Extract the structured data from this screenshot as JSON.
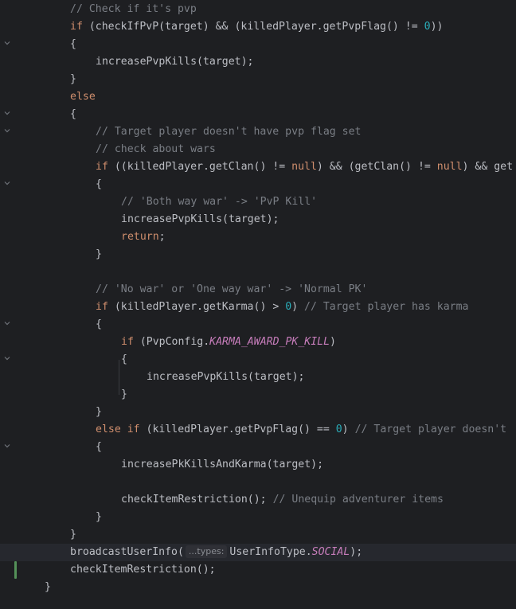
{
  "colors": {
    "background": "#1e1f22",
    "keyword": "#cf8e6d",
    "number": "#2aacb8",
    "comment": "#7a7e85",
    "constant": "#c77dbb",
    "text": "#bcbec4",
    "vcs_added": "#549159"
  },
  "gutter_icons": [
    "chevron-down-icon"
  ],
  "lines": [
    {
      "indent": 1,
      "tokens": [
        {
          "t": "comment",
          "v": "// Check if it's pvp"
        }
      ]
    },
    {
      "indent": 1,
      "tokens": [
        {
          "t": "kw",
          "v": "if"
        },
        {
          "t": "plain",
          "v": " (checkIfPvP(target) && (killedPlayer.getPvpFlag() != "
        },
        {
          "t": "num",
          "v": "0"
        },
        {
          "t": "plain",
          "v": "))"
        }
      ]
    },
    {
      "indent": 1,
      "fold": true,
      "tokens": [
        {
          "t": "plain",
          "v": "{"
        }
      ]
    },
    {
      "indent": 2,
      "tokens": [
        {
          "t": "plain",
          "v": "increasePvpKills(target);"
        }
      ]
    },
    {
      "indent": 1,
      "tokens": [
        {
          "t": "plain",
          "v": "}"
        }
      ]
    },
    {
      "indent": 1,
      "tokens": [
        {
          "t": "kw",
          "v": "else"
        }
      ]
    },
    {
      "indent": 1,
      "fold": true,
      "tokens": [
        {
          "t": "plain",
          "v": "{"
        }
      ]
    },
    {
      "indent": 2,
      "fold": true,
      "tokens": [
        {
          "t": "comment",
          "v": "// Target player doesn't have pvp flag set"
        }
      ]
    },
    {
      "indent": 2,
      "tokens": [
        {
          "t": "comment",
          "v": "// check about wars"
        }
      ]
    },
    {
      "indent": 2,
      "tokens": [
        {
          "t": "kw",
          "v": "if"
        },
        {
          "t": "plain",
          "v": " ((killedPlayer.getClan() != "
        },
        {
          "t": "kw",
          "v": "null"
        },
        {
          "t": "plain",
          "v": ") && (getClan() != "
        },
        {
          "t": "kw",
          "v": "null"
        },
        {
          "t": "plain",
          "v": ") && get"
        }
      ]
    },
    {
      "indent": 2,
      "fold": true,
      "tokens": [
        {
          "t": "plain",
          "v": "{"
        }
      ]
    },
    {
      "indent": 3,
      "tokens": [
        {
          "t": "comment",
          "v": "// 'Both way war' -> 'PvP Kill'"
        }
      ]
    },
    {
      "indent": 3,
      "tokens": [
        {
          "t": "plain",
          "v": "increasePvpKills(target);"
        }
      ]
    },
    {
      "indent": 3,
      "tokens": [
        {
          "t": "kw",
          "v": "return"
        },
        {
          "t": "plain",
          "v": ";"
        }
      ]
    },
    {
      "indent": 2,
      "tokens": [
        {
          "t": "plain",
          "v": "}"
        }
      ]
    },
    {
      "indent": 0,
      "tokens": []
    },
    {
      "indent": 2,
      "tokens": [
        {
          "t": "comment",
          "v": "// 'No war' or 'One way war' -> 'Normal PK'"
        }
      ]
    },
    {
      "indent": 2,
      "tokens": [
        {
          "t": "kw",
          "v": "if"
        },
        {
          "t": "plain",
          "v": " (killedPlayer.getKarma() > "
        },
        {
          "t": "num",
          "v": "0"
        },
        {
          "t": "plain",
          "v": ") "
        },
        {
          "t": "comment",
          "v": "// Target player has karma"
        }
      ]
    },
    {
      "indent": 2,
      "fold": true,
      "tokens": [
        {
          "t": "plain",
          "v": "{"
        }
      ]
    },
    {
      "indent": 3,
      "tokens": [
        {
          "t": "kw",
          "v": "if"
        },
        {
          "t": "plain",
          "v": " (PvpConfig."
        },
        {
          "t": "const",
          "v": "KARMA_AWARD_PK_KILL"
        },
        {
          "t": "plain",
          "v": ")"
        }
      ]
    },
    {
      "indent": 3,
      "fold": true,
      "tokens": [
        {
          "t": "plain",
          "v": "{"
        }
      ]
    },
    {
      "indent": 4,
      "tokens": [
        {
          "t": "plain",
          "v": "increasePvpKills(target);"
        }
      ]
    },
    {
      "indent": 3,
      "tokens": [
        {
          "t": "plain",
          "v": "}"
        }
      ]
    },
    {
      "indent": 2,
      "tokens": [
        {
          "t": "plain",
          "v": "}"
        }
      ]
    },
    {
      "indent": 2,
      "tokens": [
        {
          "t": "kw",
          "v": "else if"
        },
        {
          "t": "plain",
          "v": " (killedPlayer.getPvpFlag() == "
        },
        {
          "t": "num",
          "v": "0"
        },
        {
          "t": "plain",
          "v": ") "
        },
        {
          "t": "comment",
          "v": "// Target player doesn't"
        }
      ]
    },
    {
      "indent": 2,
      "fold": true,
      "tokens": [
        {
          "t": "plain",
          "v": "{"
        }
      ]
    },
    {
      "indent": 3,
      "tokens": [
        {
          "t": "plain",
          "v": "increasePkKillsAndKarma(target);"
        }
      ]
    },
    {
      "indent": 0,
      "tokens": []
    },
    {
      "indent": 3,
      "tokens": [
        {
          "t": "plain",
          "v": "checkItemRestriction(); "
        },
        {
          "t": "comment",
          "v": "// Unequip adventurer items"
        }
      ]
    },
    {
      "indent": 2,
      "tokens": [
        {
          "t": "plain",
          "v": "}"
        }
      ]
    },
    {
      "indent": 1,
      "tokens": [
        {
          "t": "plain",
          "v": "}"
        }
      ]
    },
    {
      "indent": 1,
      "current": true,
      "vcs": true,
      "tokens": [
        {
          "t": "plain",
          "v": "broadcastUserInfo("
        },
        {
          "t": "hint",
          "v": "...types:"
        },
        {
          "t": "plain",
          "v": "UserInfoType."
        },
        {
          "t": "const",
          "v": "SOCIAL"
        },
        {
          "t": "plain",
          "v": ");"
        }
      ]
    },
    {
      "indent": 1,
      "vcs": true,
      "tokens": [
        {
          "t": "plain",
          "v": "checkItemRestriction();"
        }
      ]
    },
    {
      "indent": 0,
      "tokens": [
        {
          "t": "plain",
          "v": "}"
        }
      ]
    }
  ]
}
